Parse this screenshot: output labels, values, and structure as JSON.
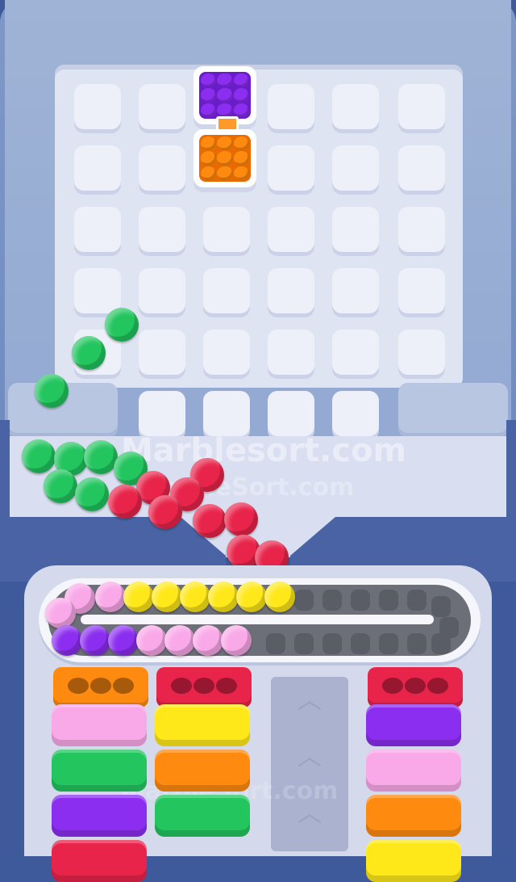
{
  "watermark": {
    "primary": "Marblesort.com",
    "secondary": "MarbleSort.com",
    "bottom": "MarbleSort.com"
  },
  "colors": {
    "green": "#22c55e",
    "red": "#e8244a",
    "yellow": "#ffe81a",
    "pink": "#f9a8e8",
    "purple": "#8b2ef0",
    "orange": "#ff8a10",
    "slot_empty": "#5b5d66"
  },
  "crates": [
    {
      "color": "purple",
      "balls": 9
    },
    {
      "color": "orange",
      "balls": 9
    }
  ],
  "conveyor": {
    "top_row": [
      "pink",
      "pink",
      "yellow",
      "yellow",
      "yellow",
      "yellow",
      "yellow",
      "yellow"
    ],
    "bottom_row": [
      "pink",
      "purple",
      "purple",
      "purple",
      "pink",
      "pink",
      "pink",
      "pink"
    ]
  },
  "columns": {
    "left": {
      "cap": "orange",
      "blocks": [
        "pink",
        "green",
        "purple",
        "red"
      ]
    },
    "center": {
      "cap": "red",
      "blocks": [
        "yellow",
        "orange",
        "green"
      ]
    },
    "right": {
      "cap": "red",
      "blocks": [
        "purple",
        "pink",
        "orange",
        "yellow"
      ]
    }
  },
  "middle_lane": {
    "icon": "chevron-up-icon"
  }
}
